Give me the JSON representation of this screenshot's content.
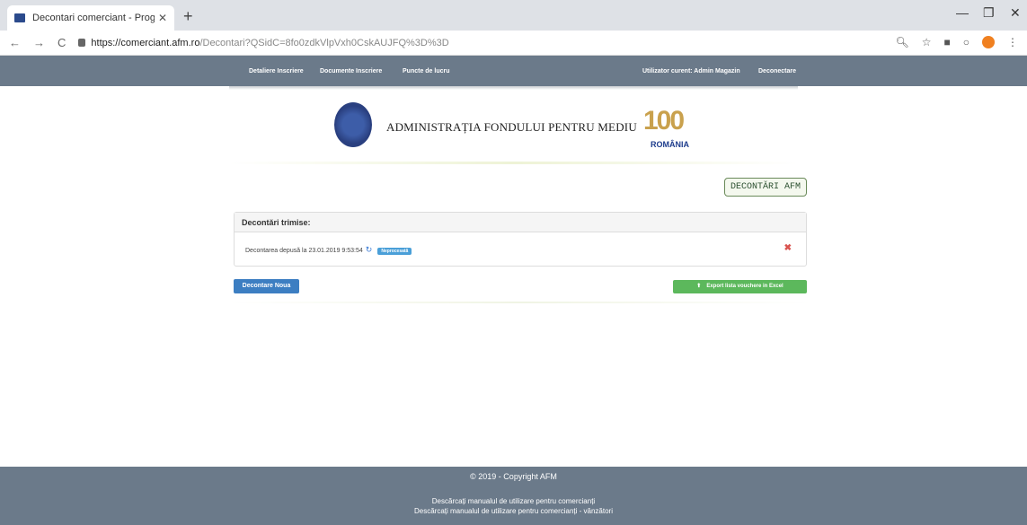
{
  "browser": {
    "tab_title": "Decontari comerciant - Program",
    "url_host": "https://comerciant.afm.ro",
    "url_path": "/Decontari?QSidC=8fo0zdkVlpVxh0CskAUJFQ%3D%3D"
  },
  "nav": {
    "left": [
      "Detaliere Inscriere",
      "Documente Inscriere",
      "Puncte de lucru"
    ],
    "user": "Utilizator curent: Admin Magazin",
    "logout": "Deconectare"
  },
  "header": {
    "agency": "ADMINISTRAȚIA FONDULUI PENTRU MEDIU",
    "centenary_number": "100",
    "centenary_label": "ROMÂNIA"
  },
  "afm_button": "DECONTĂRI AFM",
  "panel": {
    "title": "Decontări trimise:",
    "row_text": "Decontarea depusă la 23.01.2019 9:53:54",
    "badge": "Neprocesată"
  },
  "buttons": {
    "new": "Decontare Noua",
    "excel": "Export lista vouchere in Excel"
  },
  "footer": {
    "copyright": "© 2019 - Copyright AFM",
    "manual1": "Descărcați manualul de utilizare pentru comercianți",
    "manual2": "Descărcați manualul de utilizare pentru comercianți - vânzători"
  }
}
